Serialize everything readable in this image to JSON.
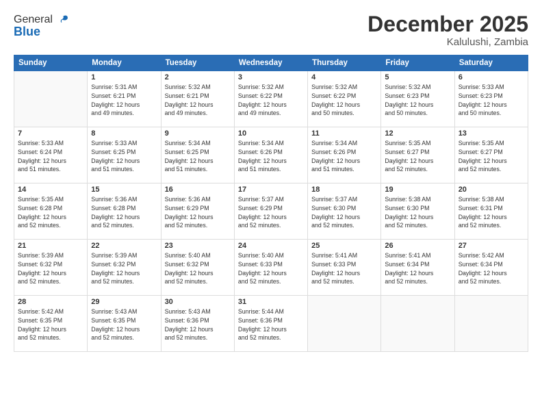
{
  "logo": {
    "general": "General",
    "blue": "Blue"
  },
  "header": {
    "month_year": "December 2025",
    "location": "Kalulushi, Zambia"
  },
  "weekdays": [
    "Sunday",
    "Monday",
    "Tuesday",
    "Wednesday",
    "Thursday",
    "Friday",
    "Saturday"
  ],
  "weeks": [
    [
      {
        "day": "",
        "info": ""
      },
      {
        "day": "1",
        "info": "Sunrise: 5:31 AM\nSunset: 6:21 PM\nDaylight: 12 hours\nand 49 minutes."
      },
      {
        "day": "2",
        "info": "Sunrise: 5:32 AM\nSunset: 6:21 PM\nDaylight: 12 hours\nand 49 minutes."
      },
      {
        "day": "3",
        "info": "Sunrise: 5:32 AM\nSunset: 6:22 PM\nDaylight: 12 hours\nand 49 minutes."
      },
      {
        "day": "4",
        "info": "Sunrise: 5:32 AM\nSunset: 6:22 PM\nDaylight: 12 hours\nand 50 minutes."
      },
      {
        "day": "5",
        "info": "Sunrise: 5:32 AM\nSunset: 6:23 PM\nDaylight: 12 hours\nand 50 minutes."
      },
      {
        "day": "6",
        "info": "Sunrise: 5:33 AM\nSunset: 6:23 PM\nDaylight: 12 hours\nand 50 minutes."
      }
    ],
    [
      {
        "day": "7",
        "info": "Sunrise: 5:33 AM\nSunset: 6:24 PM\nDaylight: 12 hours\nand 51 minutes."
      },
      {
        "day": "8",
        "info": "Sunrise: 5:33 AM\nSunset: 6:25 PM\nDaylight: 12 hours\nand 51 minutes."
      },
      {
        "day": "9",
        "info": "Sunrise: 5:34 AM\nSunset: 6:25 PM\nDaylight: 12 hours\nand 51 minutes."
      },
      {
        "day": "10",
        "info": "Sunrise: 5:34 AM\nSunset: 6:26 PM\nDaylight: 12 hours\nand 51 minutes."
      },
      {
        "day": "11",
        "info": "Sunrise: 5:34 AM\nSunset: 6:26 PM\nDaylight: 12 hours\nand 51 minutes."
      },
      {
        "day": "12",
        "info": "Sunrise: 5:35 AM\nSunset: 6:27 PM\nDaylight: 12 hours\nand 52 minutes."
      },
      {
        "day": "13",
        "info": "Sunrise: 5:35 AM\nSunset: 6:27 PM\nDaylight: 12 hours\nand 52 minutes."
      }
    ],
    [
      {
        "day": "14",
        "info": "Sunrise: 5:35 AM\nSunset: 6:28 PM\nDaylight: 12 hours\nand 52 minutes."
      },
      {
        "day": "15",
        "info": "Sunrise: 5:36 AM\nSunset: 6:28 PM\nDaylight: 12 hours\nand 52 minutes."
      },
      {
        "day": "16",
        "info": "Sunrise: 5:36 AM\nSunset: 6:29 PM\nDaylight: 12 hours\nand 52 minutes."
      },
      {
        "day": "17",
        "info": "Sunrise: 5:37 AM\nSunset: 6:29 PM\nDaylight: 12 hours\nand 52 minutes."
      },
      {
        "day": "18",
        "info": "Sunrise: 5:37 AM\nSunset: 6:30 PM\nDaylight: 12 hours\nand 52 minutes."
      },
      {
        "day": "19",
        "info": "Sunrise: 5:38 AM\nSunset: 6:30 PM\nDaylight: 12 hours\nand 52 minutes."
      },
      {
        "day": "20",
        "info": "Sunrise: 5:38 AM\nSunset: 6:31 PM\nDaylight: 12 hours\nand 52 minutes."
      }
    ],
    [
      {
        "day": "21",
        "info": "Sunrise: 5:39 AM\nSunset: 6:32 PM\nDaylight: 12 hours\nand 52 minutes."
      },
      {
        "day": "22",
        "info": "Sunrise: 5:39 AM\nSunset: 6:32 PM\nDaylight: 12 hours\nand 52 minutes."
      },
      {
        "day": "23",
        "info": "Sunrise: 5:40 AM\nSunset: 6:32 PM\nDaylight: 12 hours\nand 52 minutes."
      },
      {
        "day": "24",
        "info": "Sunrise: 5:40 AM\nSunset: 6:33 PM\nDaylight: 12 hours\nand 52 minutes."
      },
      {
        "day": "25",
        "info": "Sunrise: 5:41 AM\nSunset: 6:33 PM\nDaylight: 12 hours\nand 52 minutes."
      },
      {
        "day": "26",
        "info": "Sunrise: 5:41 AM\nSunset: 6:34 PM\nDaylight: 12 hours\nand 52 minutes."
      },
      {
        "day": "27",
        "info": "Sunrise: 5:42 AM\nSunset: 6:34 PM\nDaylight: 12 hours\nand 52 minutes."
      }
    ],
    [
      {
        "day": "28",
        "info": "Sunrise: 5:42 AM\nSunset: 6:35 PM\nDaylight: 12 hours\nand 52 minutes."
      },
      {
        "day": "29",
        "info": "Sunrise: 5:43 AM\nSunset: 6:35 PM\nDaylight: 12 hours\nand 52 minutes."
      },
      {
        "day": "30",
        "info": "Sunrise: 5:43 AM\nSunset: 6:36 PM\nDaylight: 12 hours\nand 52 minutes."
      },
      {
        "day": "31",
        "info": "Sunrise: 5:44 AM\nSunset: 6:36 PM\nDaylight: 12 hours\nand 52 minutes."
      },
      {
        "day": "",
        "info": ""
      },
      {
        "day": "",
        "info": ""
      },
      {
        "day": "",
        "info": ""
      }
    ]
  ]
}
